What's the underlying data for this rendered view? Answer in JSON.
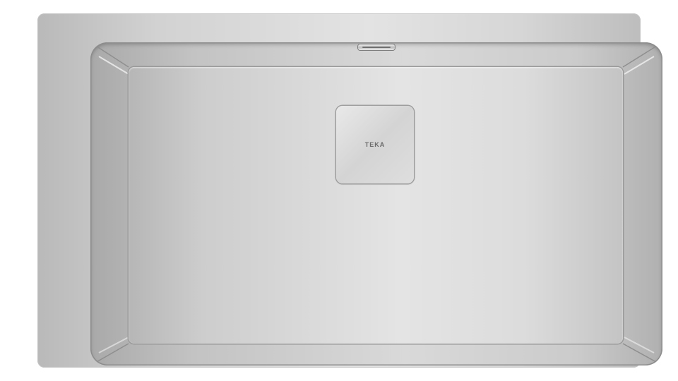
{
  "product": {
    "brand": "TEKA"
  },
  "colors": {
    "steel_light": "#e3e3e3",
    "steel_mid": "#cdcdcd",
    "steel_dark": "#9a9a9a",
    "background": "#ffffff"
  },
  "icons": {
    "drain": "drain-cover-icon",
    "overflow": "overflow-slot-icon"
  }
}
